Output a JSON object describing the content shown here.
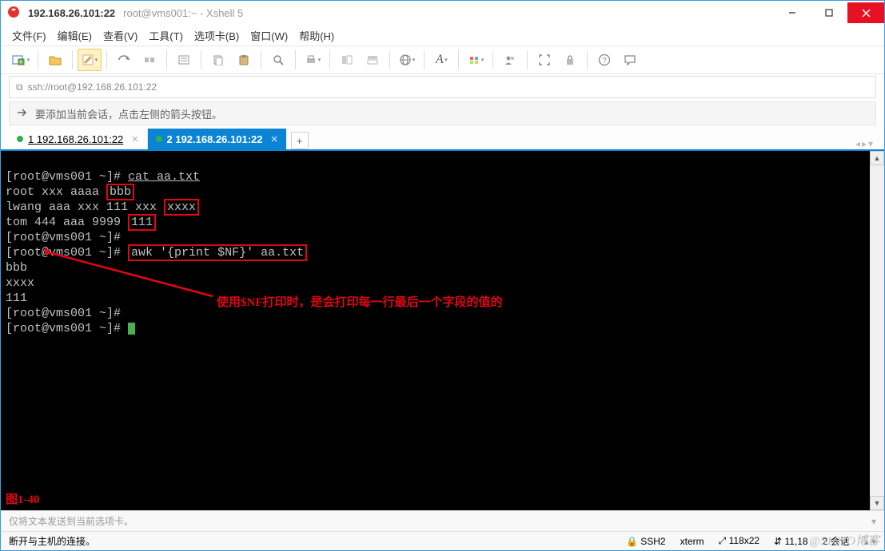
{
  "titlebar": {
    "main": "192.168.26.101:22",
    "sub": "root@vms001:~ - Xshell 5"
  },
  "menubar": [
    "文件(F)",
    "编辑(E)",
    "查看(V)",
    "工具(T)",
    "选项卡(B)",
    "窗口(W)",
    "帮助(H)"
  ],
  "addressbar": {
    "icon": "⧉",
    "url": "ssh://root@192.168.26.101:22"
  },
  "hintbar": "要添加当前会话，点击左侧的箭头按钮。",
  "tabs": [
    {
      "label": "1 192.168.26.101:22",
      "active": false
    },
    {
      "label": "2 192.168.26.101:22",
      "active": true
    }
  ],
  "terminal": {
    "p": "[root@vms001 ~]#",
    "cmd_cat": "cat aa.txt",
    "l1a": "root xxx aaaa ",
    "l1b": "bbb",
    "l2a": "lwang aaa xxx 111 xxx ",
    "l2b": "xxxx",
    "l3a": "tom 444 aaa 9999 ",
    "l3b": "111",
    "cmd_awk": "awk '{print $NF}' aa.txt",
    "out1": "bbb",
    "out2": "xxxx",
    "out3": "111"
  },
  "annotation": "使用$NF打印时，是会打印每一行最后一个字段的值的",
  "figlabel": "图1-40",
  "sendbar": "仅将文本发送到当前选项卡。",
  "statusbar": {
    "left": "断开与主机的连接。",
    "ssh": "SSH2",
    "term": "xterm",
    "size": "118x22",
    "pos": "11,18",
    "sess": "2 会话"
  },
  "sizeicon": "⤢",
  "posicon": "⇵",
  "lockicon": "🔒",
  "dd": "▾",
  "watermark": "@51CTO博客"
}
